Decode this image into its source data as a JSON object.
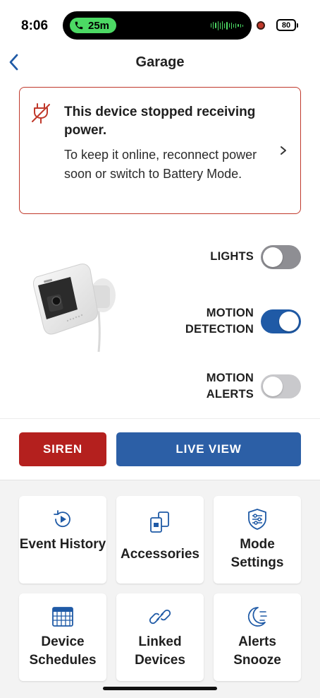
{
  "status_bar": {
    "time": "8:06",
    "call_duration": "25m",
    "battery": "80"
  },
  "header": {
    "title": "Garage",
    "back_icon": "chevron-left-icon"
  },
  "alert": {
    "title": "This device stopped receiving power.",
    "body": "To keep it online, reconnect power soon or switch to Battery Mode.",
    "icon": "power-disconnected-icon",
    "accent_color": "#c0392b"
  },
  "toggles": {
    "lights": {
      "label": "LIGHTS",
      "state": "off"
    },
    "motion_detection": {
      "label": "MOTION DETECTION",
      "state": "on"
    },
    "motion_alerts": {
      "label": "MOTION ALERTS",
      "state": "off"
    }
  },
  "actions": {
    "siren": "SIREN",
    "live_view": "LIVE VIEW",
    "siren_color": "#b4201e",
    "live_view_color": "#2c5fa6"
  },
  "tiles": [
    {
      "label": "Event History",
      "icon": "history-play-icon"
    },
    {
      "label": "Accessories",
      "icon": "accessories-icon"
    },
    {
      "label": "Mode Settings",
      "icon": "mode-shield-sliders-icon"
    },
    {
      "label": "Device Schedules",
      "icon": "calendar-icon"
    },
    {
      "label": "Linked Devices",
      "icon": "link-icon"
    },
    {
      "label": "Alerts Snooze",
      "icon": "snooze-moon-icon"
    }
  ]
}
